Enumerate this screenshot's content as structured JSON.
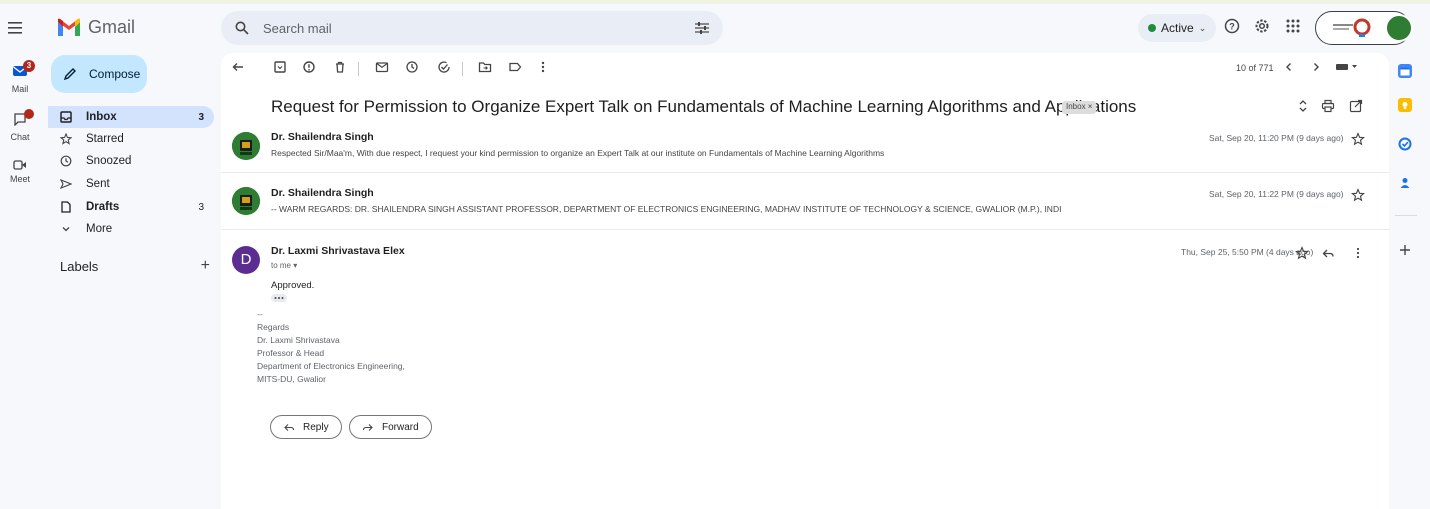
{
  "app": {
    "name": "Gmail",
    "brand_color": "#ea4335"
  },
  "search": {
    "placeholder": "Search mail"
  },
  "header": {
    "status_label": "Active"
  },
  "rail": {
    "mail": {
      "label": "Mail",
      "badge": "3"
    },
    "chat": {
      "label": "Chat"
    },
    "meet": {
      "label": "Meet"
    }
  },
  "nav": {
    "compose_label": "Compose",
    "items": [
      {
        "label": "Inbox",
        "count": "3",
        "icon": "inbox-icon"
      },
      {
        "label": "Starred",
        "count": "",
        "icon": "star-icon"
      },
      {
        "label": "Snoozed",
        "count": "",
        "icon": "clock-icon"
      },
      {
        "label": "Sent",
        "count": "",
        "icon": "send-icon"
      },
      {
        "label": "Drafts",
        "count": "3",
        "icon": "draft-icon"
      },
      {
        "label": "More",
        "count": "",
        "icon": "chevron-down-icon"
      }
    ],
    "labels_heading": "Labels"
  },
  "toolbar": {
    "pager": "10 of 771"
  },
  "thread": {
    "subject": "Request for Permission to Organize Expert Talk on Fundamentals of Machine Learning Algorithms and Applications",
    "label_tag": "Inbox ×",
    "messages": [
      {
        "sender": "Dr. Shailendra Singh",
        "snippet": "Respected Sir/Maa'm, With due respect, I request your kind permission to organize an Expert Talk at our institute on Fundamentals of Machine Learning Algorithms",
        "date": "Sat, Sep 20, 11:20 PM (9 days ago)"
      },
      {
        "sender": "Dr. Shailendra Singh",
        "snippet": "-- WARM REGARDS: DR. SHAILENDRA SINGH ASSISTANT PROFESSOR, DEPARTMENT OF ELECTRONICS ENGINEERING, MADHAV INSTITUTE OF TECHNOLOGY & SCIENCE, GWALIOR (M.P.), INDI",
        "date": "Sat, Sep 20, 11:22 PM (9 days ago)"
      },
      {
        "sender": "Dr. Laxmi Shrivastava Elex",
        "avatar_letter": "D",
        "to": "to me ▾",
        "date": "Thu, Sep 25, 5:50 PM (4 days ago)",
        "body": "Approved.",
        "signature": [
          "--",
          "Regards",
          "Dr. Laxmi Shrivastava",
          "Professor & Head",
          "Department of Electronics Engineering,",
          "MITS-DU, Gwalior"
        ]
      }
    ],
    "reply_label": "Reply",
    "forward_label": "Forward"
  }
}
